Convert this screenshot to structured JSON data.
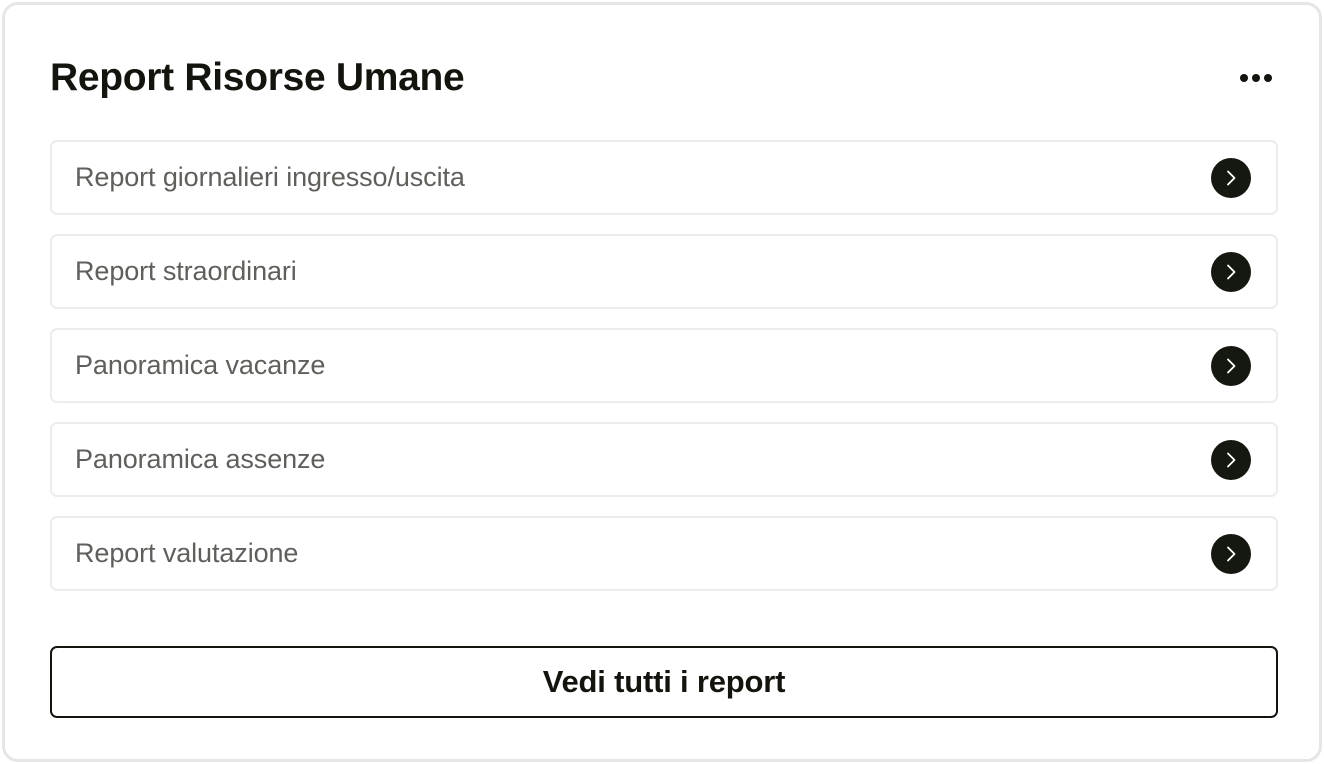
{
  "header": {
    "title": "Report Risorse Umane",
    "menu_icon": "more-horizontal-icon"
  },
  "reports": [
    {
      "label": "Report giornalieri ingresso/uscita",
      "icon": "chevron-right-icon"
    },
    {
      "label": "Report straordinari",
      "icon": "chevron-right-icon"
    },
    {
      "label": "Panoramica vacanze",
      "icon": "chevron-right-icon"
    },
    {
      "label": "Panoramica assenze",
      "icon": "chevron-right-icon"
    },
    {
      "label": "Report valutazione",
      "icon": "chevron-right-icon"
    }
  ],
  "footer": {
    "view_all_label": "Vedi tutti i report"
  },
  "colors": {
    "text_primary": "#14140f",
    "text_secondary": "#5f5f5b",
    "icon_bg": "#151810",
    "border": "#ececec"
  }
}
